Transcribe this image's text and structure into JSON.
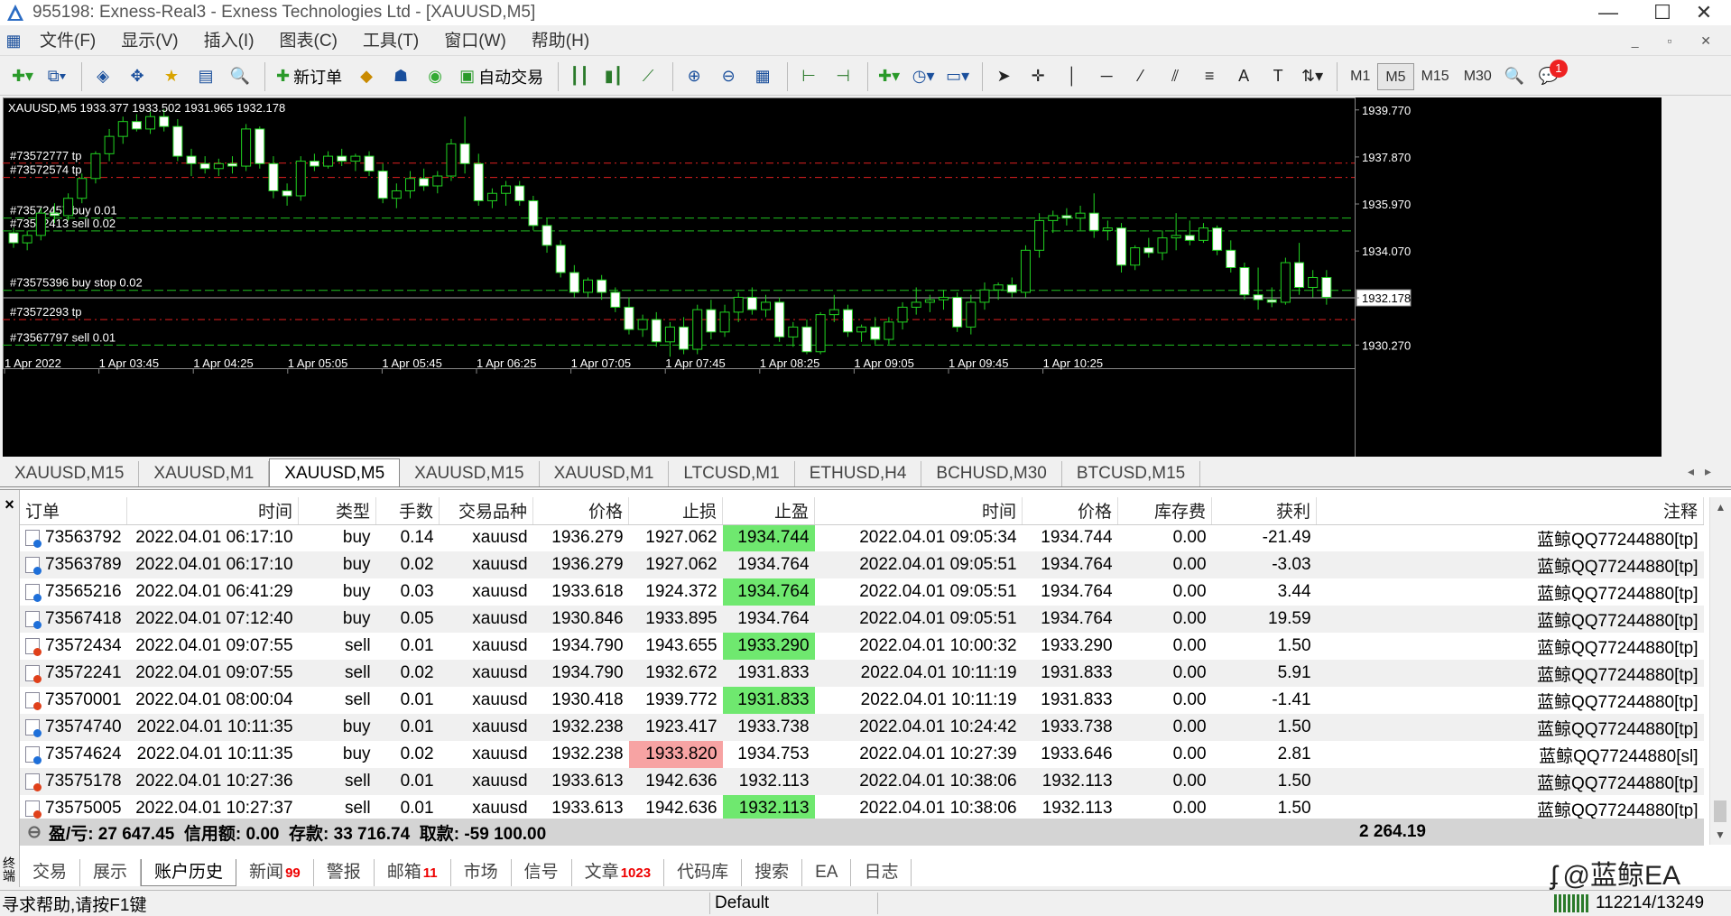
{
  "window": {
    "title": "955198: Exness-Real3 - Exness Technologies Ltd - [XAUUSD,M5]",
    "controls": [
      "—",
      "☐",
      "✕"
    ]
  },
  "menu": [
    "文件(F)",
    "显示(V)",
    "插入(I)",
    "图表(C)",
    "工具(T)",
    "窗口(W)",
    "帮助(H)"
  ],
  "toolbar": {
    "new_order": "新订单",
    "auto_trade": "自动交易",
    "timeframes": [
      "M1",
      "M5",
      "M15",
      "M30"
    ],
    "active_timeframe": "M5",
    "notification_count": "1"
  },
  "chart": {
    "header": "XAUUSD,M5  1933.377 1933.502 1931.965 1932.178",
    "current_price": "1932.178",
    "price_ticks": [
      "1939.770",
      "1937.870",
      "1935.970",
      "1934.070",
      "1932.178",
      "1930.270"
    ],
    "time_ticks": [
      "1 Apr 2022",
      "1 Apr 03:45",
      "1 Apr 04:25",
      "1 Apr 05:05",
      "1 Apr 05:45",
      "1 Apr 06:25",
      "1 Apr 07:05",
      "1 Apr 07:45",
      "1 Apr 08:25",
      "1 Apr 09:05",
      "1 Apr 09:45",
      "1 Apr 10:25"
    ],
    "order_labels": [
      {
        "text": "#73572777 tp",
        "price": 1937.62,
        "color": "#e02020"
      },
      {
        "text": "#73572574 tp",
        "price": 1937.04,
        "color": "#e02020"
      },
      {
        "text": "#73572457  buy 0.01",
        "price": 1935.4,
        "color": "#20c020"
      },
      {
        "text": "#73572413 sell 0.02",
        "price": 1934.88,
        "color": "#20c020"
      },
      {
        "text": "#73575396 buy stop 0.02",
        "price": 1932.48,
        "color": "#20c020"
      },
      {
        "text": "#73572293 tp",
        "price": 1931.3,
        "color": "#e02020"
      },
      {
        "text": "#73567797 sell 0.01",
        "price": 1930.27,
        "color": "#20c020"
      }
    ],
    "price_range": [
      1929.7,
      1940.2
    ]
  },
  "chart_tabs": [
    "XAUUSD,M15",
    "XAUUSD,M1",
    "XAUUSD,M5",
    "XAUUSD,M15",
    "XAUUSD,M1",
    "LTCUSD,M1",
    "ETHUSD,H4",
    "BCHUSD,M30",
    "BTCUSD,M15"
  ],
  "active_chart_tab": 2,
  "history": {
    "columns": [
      "订单",
      "时间",
      "类型",
      "手数",
      "交易品种",
      "价格",
      "止损",
      "止盈",
      "时间",
      "价格",
      "库存费",
      "获利",
      "注释"
    ],
    "rows": [
      {
        "order": "73563792",
        "open_time": "2022.04.01 06:17:10",
        "type": "buy",
        "lots": "0.14",
        "symbol": "xauusd",
        "price": "1936.279",
        "sl": "1927.062",
        "tp": "1934.744",
        "close_time": "2022.04.01 09:05:34",
        "close_price": "1934.744",
        "swap": "0.00",
        "profit": "-21.49",
        "comment": "蓝鲸QQ77244880[tp]",
        "hit": "tp"
      },
      {
        "order": "73563789",
        "open_time": "2022.04.01 06:17:10",
        "type": "buy",
        "lots": "0.02",
        "symbol": "xauusd",
        "price": "1936.279",
        "sl": "1927.062",
        "tp": "1934.764",
        "close_time": "2022.04.01 09:05:51",
        "close_price": "1934.764",
        "swap": "0.00",
        "profit": "-3.03",
        "comment": "蓝鲸QQ77244880[tp]",
        "hit": "tp"
      },
      {
        "order": "73565216",
        "open_time": "2022.04.01 06:41:29",
        "type": "buy",
        "lots": "0.03",
        "symbol": "xauusd",
        "price": "1933.618",
        "sl": "1924.372",
        "tp": "1934.764",
        "close_time": "2022.04.01 09:05:51",
        "close_price": "1934.764",
        "swap": "0.00",
        "profit": "3.44",
        "comment": "蓝鲸QQ77244880[tp]",
        "hit": "tp"
      },
      {
        "order": "73567418",
        "open_time": "2022.04.01 07:12:40",
        "type": "buy",
        "lots": "0.05",
        "symbol": "xauusd",
        "price": "1930.846",
        "sl": "1933.895",
        "tp": "1934.764",
        "close_time": "2022.04.01 09:05:51",
        "close_price": "1934.764",
        "swap": "0.00",
        "profit": "19.59",
        "comment": "蓝鲸QQ77244880[tp]",
        "hit": "tp"
      },
      {
        "order": "73572434",
        "open_time": "2022.04.01 09:07:55",
        "type": "sell",
        "lots": "0.01",
        "symbol": "xauusd",
        "price": "1934.790",
        "sl": "1943.655",
        "tp": "1933.290",
        "close_time": "2022.04.01 10:00:32",
        "close_price": "1933.290",
        "swap": "0.00",
        "profit": "1.50",
        "comment": "蓝鲸QQ77244880[tp]",
        "hit": "tp"
      },
      {
        "order": "73572241",
        "open_time": "2022.04.01 09:07:55",
        "type": "sell",
        "lots": "0.02",
        "symbol": "xauusd",
        "price": "1934.790",
        "sl": "1932.672",
        "tp": "1931.833",
        "close_time": "2022.04.01 10:11:19",
        "close_price": "1931.833",
        "swap": "0.00",
        "profit": "5.91",
        "comment": "蓝鲸QQ77244880[tp]",
        "hit": "tp"
      },
      {
        "order": "73570001",
        "open_time": "2022.04.01 08:00:04",
        "type": "sell",
        "lots": "0.01",
        "symbol": "xauusd",
        "price": "1930.418",
        "sl": "1939.772",
        "tp": "1931.833",
        "close_time": "2022.04.01 10:11:19",
        "close_price": "1931.833",
        "swap": "0.00",
        "profit": "-1.41",
        "comment": "蓝鲸QQ77244880[tp]",
        "hit": "tp"
      },
      {
        "order": "73574740",
        "open_time": "2022.04.01 10:11:35",
        "type": "buy",
        "lots": "0.01",
        "symbol": "xauusd",
        "price": "1932.238",
        "sl": "1923.417",
        "tp": "1933.738",
        "close_time": "2022.04.01 10:24:42",
        "close_price": "1933.738",
        "swap": "0.00",
        "profit": "1.50",
        "comment": "蓝鲸QQ77244880[tp]",
        "hit": "tp"
      },
      {
        "order": "73574624",
        "open_time": "2022.04.01 10:11:35",
        "type": "buy",
        "lots": "0.02",
        "symbol": "xauusd",
        "price": "1932.238",
        "sl": "1933.820",
        "tp": "1934.753",
        "close_time": "2022.04.01 10:27:39",
        "close_price": "1933.646",
        "swap": "0.00",
        "profit": "2.81",
        "comment": "蓝鲸QQ77244880[sl]",
        "hit": "sl"
      },
      {
        "order": "73575178",
        "open_time": "2022.04.01 10:27:36",
        "type": "sell",
        "lots": "0.01",
        "symbol": "xauusd",
        "price": "1933.613",
        "sl": "1942.636",
        "tp": "1932.113",
        "close_time": "2022.04.01 10:38:06",
        "close_price": "1932.113",
        "swap": "0.00",
        "profit": "1.50",
        "comment": "蓝鲸QQ77244880[tp]",
        "hit": "tp"
      },
      {
        "order": "73575005",
        "open_time": "2022.04.01 10:27:37",
        "type": "sell",
        "lots": "0.01",
        "symbol": "xauusd",
        "price": "1933.613",
        "sl": "1942.636",
        "tp": "1932.113",
        "close_time": "2022.04.01 10:38:06",
        "close_price": "1932.113",
        "swap": "0.00",
        "profit": "1.50",
        "comment": "蓝鲸QQ77244880[tp]",
        "hit": "tp"
      }
    ],
    "summary": "盈/亏: 27 647.45  信用额: 0.00  存款: 33 716.74  取款: -59 100.00",
    "summary_profit": "2 264.19"
  },
  "bottom_tabs": [
    {
      "label": "交易",
      "badge": ""
    },
    {
      "label": "展示",
      "badge": ""
    },
    {
      "label": "账户历史",
      "badge": ""
    },
    {
      "label": "新闻",
      "badge": "99"
    },
    {
      "label": "警报",
      "badge": ""
    },
    {
      "label": "邮箱",
      "badge": "11"
    },
    {
      "label": "市场",
      "badge": ""
    },
    {
      "label": "信号",
      "badge": ""
    },
    {
      "label": "文章",
      "badge": "1023"
    },
    {
      "label": "代码库",
      "badge": ""
    },
    {
      "label": "搜索",
      "badge": ""
    },
    {
      "label": "EA",
      "badge": ""
    },
    {
      "label": "日志",
      "badge": ""
    }
  ],
  "active_bottom_tab": 2,
  "side_label": "终端",
  "status": {
    "help": "寻求帮助,请按F1键",
    "profile": "Default",
    "traffic": "112214/13249"
  },
  "watermark": "@蓝鲸EA",
  "candles": [
    [
      1934.8,
      1935.0,
      1934.2,
      1934.4
    ],
    [
      1934.4,
      1934.9,
      1934.1,
      1934.7
    ],
    [
      1934.7,
      1935.8,
      1934.5,
      1935.6
    ],
    [
      1935.6,
      1936.0,
      1935.2,
      1935.5
    ],
    [
      1935.5,
      1936.4,
      1935.3,
      1936.2
    ],
    [
      1936.2,
      1937.2,
      1936.0,
      1937.0
    ],
    [
      1937.0,
      1938.1,
      1936.8,
      1938.0
    ],
    [
      1938.0,
      1939.0,
      1937.7,
      1938.7
    ],
    [
      1938.7,
      1939.5,
      1938.4,
      1939.3
    ],
    [
      1939.3,
      1939.6,
      1938.9,
      1939.0
    ],
    [
      1939.0,
      1939.7,
      1938.8,
      1939.5
    ],
    [
      1939.5,
      1939.8,
      1938.9,
      1939.1
    ],
    [
      1939.1,
      1939.4,
      1937.7,
      1937.9
    ],
    [
      1937.9,
      1938.2,
      1937.1,
      1937.6
    ],
    [
      1937.6,
      1937.9,
      1937.2,
      1937.4
    ],
    [
      1937.4,
      1937.8,
      1937.1,
      1937.6
    ],
    [
      1937.6,
      1937.9,
      1937.2,
      1937.5
    ],
    [
      1937.5,
      1939.2,
      1937.3,
      1939.0
    ],
    [
      1939.0,
      1939.1,
      1937.4,
      1937.6
    ],
    [
      1937.6,
      1937.9,
      1936.2,
      1936.5
    ],
    [
      1936.5,
      1936.8,
      1935.9,
      1936.3
    ],
    [
      1936.3,
      1937.9,
      1936.1,
      1937.7
    ],
    [
      1937.7,
      1938.0,
      1937.3,
      1937.5
    ],
    [
      1937.5,
      1938.1,
      1937.4,
      1937.9
    ],
    [
      1937.9,
      1938.2,
      1937.5,
      1937.7
    ],
    [
      1937.7,
      1938.0,
      1937.3,
      1937.9
    ],
    [
      1937.9,
      1938.1,
      1937.1,
      1937.3
    ],
    [
      1937.3,
      1937.6,
      1936.0,
      1936.2
    ],
    [
      1936.2,
      1936.8,
      1935.8,
      1936.5
    ],
    [
      1936.5,
      1937.3,
      1936.2,
      1937.0
    ],
    [
      1937.0,
      1937.4,
      1936.5,
      1936.7
    ],
    [
      1936.7,
      1937.3,
      1936.4,
      1937.1
    ],
    [
      1937.1,
      1938.6,
      1936.9,
      1938.4
    ],
    [
      1938.4,
      1939.5,
      1937.2,
      1937.6
    ],
    [
      1937.6,
      1938.0,
      1935.9,
      1936.1
    ],
    [
      1936.1,
      1936.6,
      1935.8,
      1936.4
    ],
    [
      1936.4,
      1936.9,
      1935.9,
      1936.7
    ],
    [
      1936.7,
      1936.9,
      1935.9,
      1936.1
    ],
    [
      1936.1,
      1936.3,
      1934.9,
      1935.1
    ],
    [
      1935.1,
      1935.4,
      1934.0,
      1934.3
    ],
    [
      1934.3,
      1934.5,
      1933.0,
      1933.2
    ],
    [
      1933.2,
      1933.5,
      1932.2,
      1932.4
    ],
    [
      1932.4,
      1933.0,
      1932.2,
      1932.9
    ],
    [
      1932.9,
      1933.1,
      1932.1,
      1932.4
    ],
    [
      1932.4,
      1932.6,
      1931.6,
      1931.8
    ],
    [
      1931.8,
      1932.2,
      1930.7,
      1930.9
    ],
    [
      1930.9,
      1931.5,
      1930.6,
      1931.3
    ],
    [
      1931.3,
      1931.6,
      1930.2,
      1930.4
    ],
    [
      1930.4,
      1931.2,
      1929.8,
      1931.0
    ],
    [
      1931.0,
      1931.4,
      1929.9,
      1930.1
    ],
    [
      1930.1,
      1931.9,
      1929.9,
      1931.7
    ],
    [
      1931.7,
      1932.1,
      1930.5,
      1930.8
    ],
    [
      1930.8,
      1931.9,
      1930.6,
      1931.6
    ],
    [
      1931.6,
      1932.4,
      1931.2,
      1932.2
    ],
    [
      1932.2,
      1932.6,
      1931.5,
      1931.7
    ],
    [
      1931.7,
      1932.3,
      1931.4,
      1932.0
    ],
    [
      1932.0,
      1932.2,
      1930.4,
      1930.6
    ],
    [
      1930.6,
      1931.2,
      1930.2,
      1931.0
    ],
    [
      1931.0,
      1931.3,
      1929.9,
      1930.0
    ],
    [
      1930.0,
      1931.6,
      1929.9,
      1931.5
    ],
    [
      1931.5,
      1932.3,
      1931.2,
      1931.7
    ],
    [
      1931.7,
      1931.9,
      1930.6,
      1930.8
    ],
    [
      1930.8,
      1931.1,
      1930.4,
      1931.0
    ],
    [
      1931.0,
      1931.4,
      1930.3,
      1930.5
    ],
    [
      1930.5,
      1931.4,
      1930.3,
      1931.2
    ],
    [
      1931.2,
      1932.0,
      1930.9,
      1931.8
    ],
    [
      1931.8,
      1932.6,
      1931.5,
      1932.0
    ],
    [
      1932.0,
      1932.3,
      1931.6,
      1932.1
    ],
    [
      1932.1,
      1932.5,
      1931.7,
      1932.2
    ],
    [
      1932.2,
      1932.4,
      1930.8,
      1931.0
    ],
    [
      1931.0,
      1932.3,
      1930.7,
      1932.0
    ],
    [
      1932.0,
      1932.8,
      1931.7,
      1932.5
    ],
    [
      1932.5,
      1932.8,
      1932.1,
      1932.7
    ],
    [
      1932.7,
      1933.0,
      1932.2,
      1932.4
    ],
    [
      1932.4,
      1934.3,
      1932.2,
      1934.1
    ],
    [
      1934.1,
      1935.6,
      1933.8,
      1935.3
    ],
    [
      1935.3,
      1935.7,
      1934.8,
      1935.5
    ],
    [
      1935.5,
      1935.8,
      1935.1,
      1935.4
    ],
    [
      1935.4,
      1935.9,
      1934.9,
      1935.6
    ],
    [
      1935.6,
      1936.4,
      1934.6,
      1934.9
    ],
    [
      1934.9,
      1935.3,
      1934.5,
      1935.0
    ],
    [
      1935.0,
      1935.2,
      1933.2,
      1933.5
    ],
    [
      1933.5,
      1934.3,
      1933.3,
      1934.2
    ],
    [
      1934.2,
      1934.6,
      1933.8,
      1934.0
    ],
    [
      1934.0,
      1934.9,
      1933.7,
      1934.6
    ],
    [
      1934.6,
      1935.6,
      1934.1,
      1934.7
    ],
    [
      1934.7,
      1935.3,
      1934.3,
      1934.5
    ],
    [
      1934.5,
      1935.2,
      1934.4,
      1935.0
    ],
    [
      1935.0,
      1935.1,
      1933.9,
      1934.1
    ],
    [
      1934.1,
      1934.5,
      1933.2,
      1933.4
    ],
    [
      1933.4,
      1933.6,
      1932.1,
      1932.3
    ],
    [
      1932.3,
      1933.4,
      1931.7,
      1932.1
    ],
    [
      1932.1,
      1932.6,
      1931.8,
      1932.0
    ],
    [
      1932.0,
      1933.8,
      1931.9,
      1933.6
    ],
    [
      1933.6,
      1934.4,
      1932.3,
      1932.6
    ],
    [
      1932.6,
      1933.3,
      1932.2,
      1933.0
    ],
    [
      1933.0,
      1933.3,
      1931.9,
      1932.2
    ]
  ]
}
